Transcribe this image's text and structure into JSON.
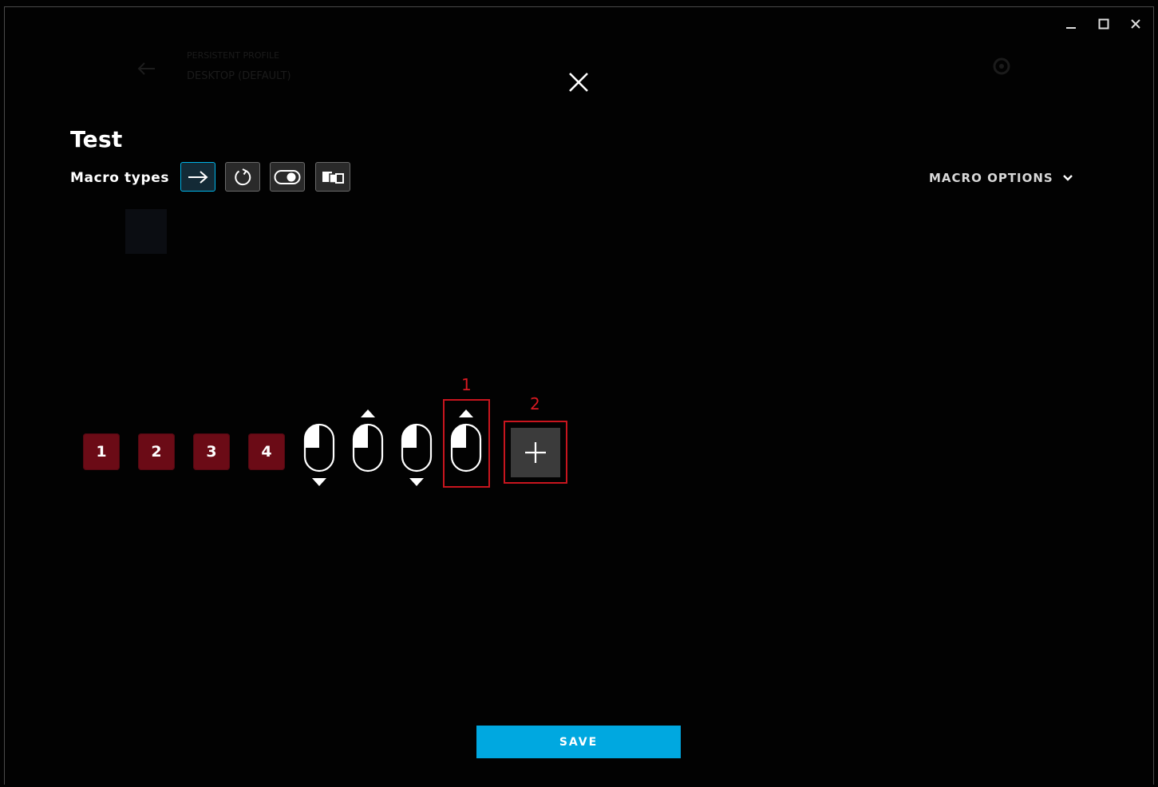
{
  "background": {
    "profile_label": "PERSISTENT PROFILE",
    "profile_name": "DESKTOP (DEFAULT)"
  },
  "macro": {
    "name": "Test",
    "types_label": "Macro types",
    "options_label": "MACRO OPTIONS",
    "types": [
      {
        "icon": "arrow-right-icon",
        "active": true
      },
      {
        "icon": "repeat-icon",
        "active": false
      },
      {
        "icon": "toggle-icon",
        "active": false
      },
      {
        "icon": "sequence-icon",
        "active": false
      }
    ],
    "keys": [
      "1",
      "2",
      "3",
      "4"
    ],
    "mouse_events": [
      {
        "icon": "left-click-icon",
        "direction": "down"
      },
      {
        "icon": "left-click-icon",
        "direction": "up"
      },
      {
        "icon": "left-click-icon",
        "direction": "down"
      },
      {
        "icon": "left-click-icon",
        "direction": "up"
      }
    ]
  },
  "annotations": [
    "1",
    "2"
  ],
  "save_label": "SAVE",
  "colors": {
    "accent": "#00a8e0",
    "key_bg": "#6b0b16",
    "annotation": "#c8151e"
  }
}
